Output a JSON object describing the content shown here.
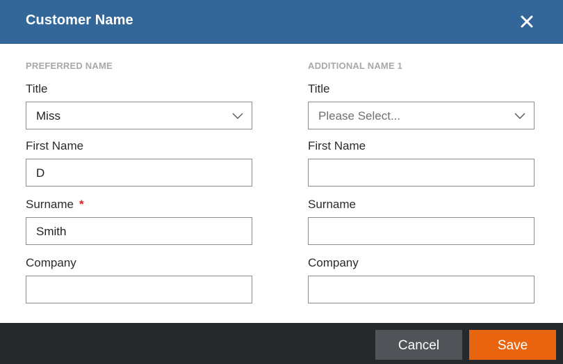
{
  "dialog": {
    "title": "Customer Name",
    "close_icon": "close-icon"
  },
  "preferred": {
    "heading": "PREFERRED NAME",
    "title_label": "Title",
    "title_value": "Miss",
    "first_name_label": "First Name",
    "first_name_value": "D",
    "surname_label": "Surname",
    "surname_required": "*",
    "surname_value": "Smith",
    "company_label": "Company",
    "company_value": ""
  },
  "additional": {
    "heading": "ADDITIONAL NAME 1",
    "title_label": "Title",
    "title_placeholder": "Please Select...",
    "first_name_label": "First Name",
    "first_name_value": "",
    "surname_label": "Surname",
    "surname_value": "",
    "company_label": "Company",
    "company_value": ""
  },
  "footer": {
    "cancel_label": "Cancel",
    "save_label": "Save"
  },
  "colors": {
    "header": "#336699",
    "footer": "#26282c",
    "save": "#e8640f",
    "cancel": "#505358",
    "required": "#e02020"
  }
}
